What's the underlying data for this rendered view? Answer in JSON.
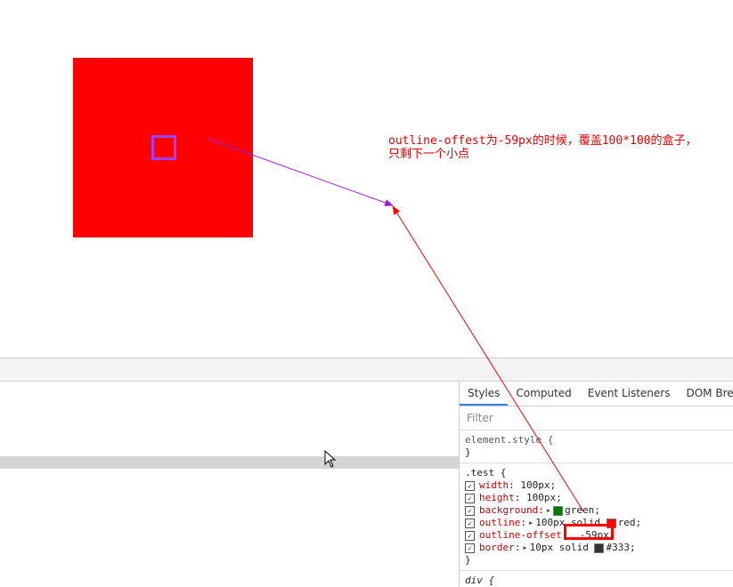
{
  "annotation": {
    "line1": "outline-offest为-59px的时候，覆盖100*100的盒子，",
    "line2": "只剩下一个小点"
  },
  "colors": {
    "box": "#ff0000",
    "dot": "#a040ff",
    "accent": "#3b7ddd"
  },
  "devtools": {
    "tabs": [
      "Styles",
      "Computed",
      "Event Listeners",
      "DOM Breakpoints"
    ],
    "filter_placeholder": "Filter",
    "element_style": {
      "selector": "element.style {",
      "close": "}"
    },
    "test_rule": {
      "selector": ".test {",
      "close": "}",
      "props": [
        {
          "name": "width",
          "value": "100px;"
        },
        {
          "name": "height",
          "value": "100px;"
        },
        {
          "name": "background",
          "value": "green;",
          "swatch": "#007a00"
        },
        {
          "name": "outline",
          "value_a": "100px solid",
          "value_b": "red;",
          "swatch": "#ff0000"
        },
        {
          "name": "outline-offset",
          "value": "-59px;"
        },
        {
          "name": "border",
          "value": "10px solid",
          "value_b": "#333;",
          "swatch": "#333333"
        }
      ]
    },
    "div_rule": {
      "selector": "div {"
    }
  }
}
